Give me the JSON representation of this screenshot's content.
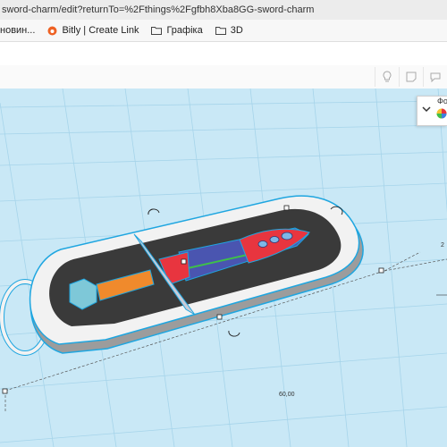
{
  "browser": {
    "address": "sword-charm/edit?returnTo=%2Fthings%2Fgfbh8Xba8GG-sword-charm",
    "bookmarks": [
      {
        "label": "новин...",
        "icon": "news-icon"
      },
      {
        "label": "Bitly | Create Link",
        "icon": "bitly-icon"
      },
      {
        "label": "Графіка",
        "icon": "folder-icon"
      },
      {
        "label": "3D",
        "icon": "folder-icon"
      }
    ]
  },
  "toolbar": {
    "icons": [
      "light-bulb-icon",
      "note-icon",
      "speech-bubble-icon"
    ]
  },
  "shape_panel": {
    "label": "Фо",
    "icons": [
      "chevron-down-icon",
      "color-swatch-icon"
    ]
  },
  "workplane": {
    "width_dimension": "60,00",
    "height_dimension": "2",
    "colors": {
      "grid": "#a6d4ea",
      "selection": "#1fa6e0",
      "base": "#eeeeee",
      "inner_plate": "#3a3a3a",
      "blade": "#4a55b0",
      "fuller": "#3fbf4a",
      "tip": "#e8353f",
      "crossguard": "#c8ccd8",
      "grip": "#f08a2c",
      "pommel": "#7ec8d8"
    }
  }
}
